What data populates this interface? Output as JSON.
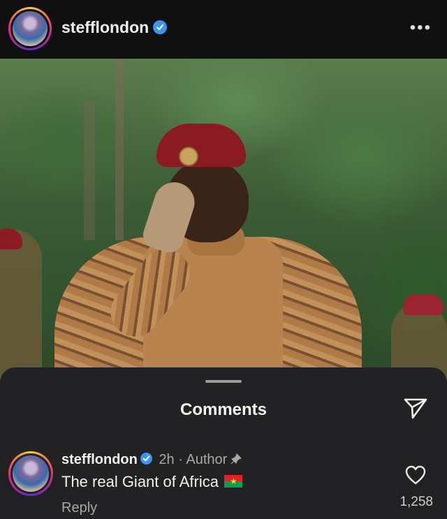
{
  "header": {
    "username": "stefflondon",
    "verified_icon": "verified-badge-icon",
    "more_label": "•••"
  },
  "post": {
    "image_icon": "post-photo"
  },
  "comments_sheet": {
    "title": "Comments",
    "share_icon": "send-icon"
  },
  "comment": {
    "username": "stefflondon",
    "time": "2h",
    "separator": "·",
    "author_label": "Author",
    "text": "The real Giant of Africa",
    "reply_label": "Reply",
    "likes": "1,258"
  },
  "colors": {
    "verified": "#3897f0",
    "sheet_bg": "#222224",
    "header_bg": "#101010"
  }
}
